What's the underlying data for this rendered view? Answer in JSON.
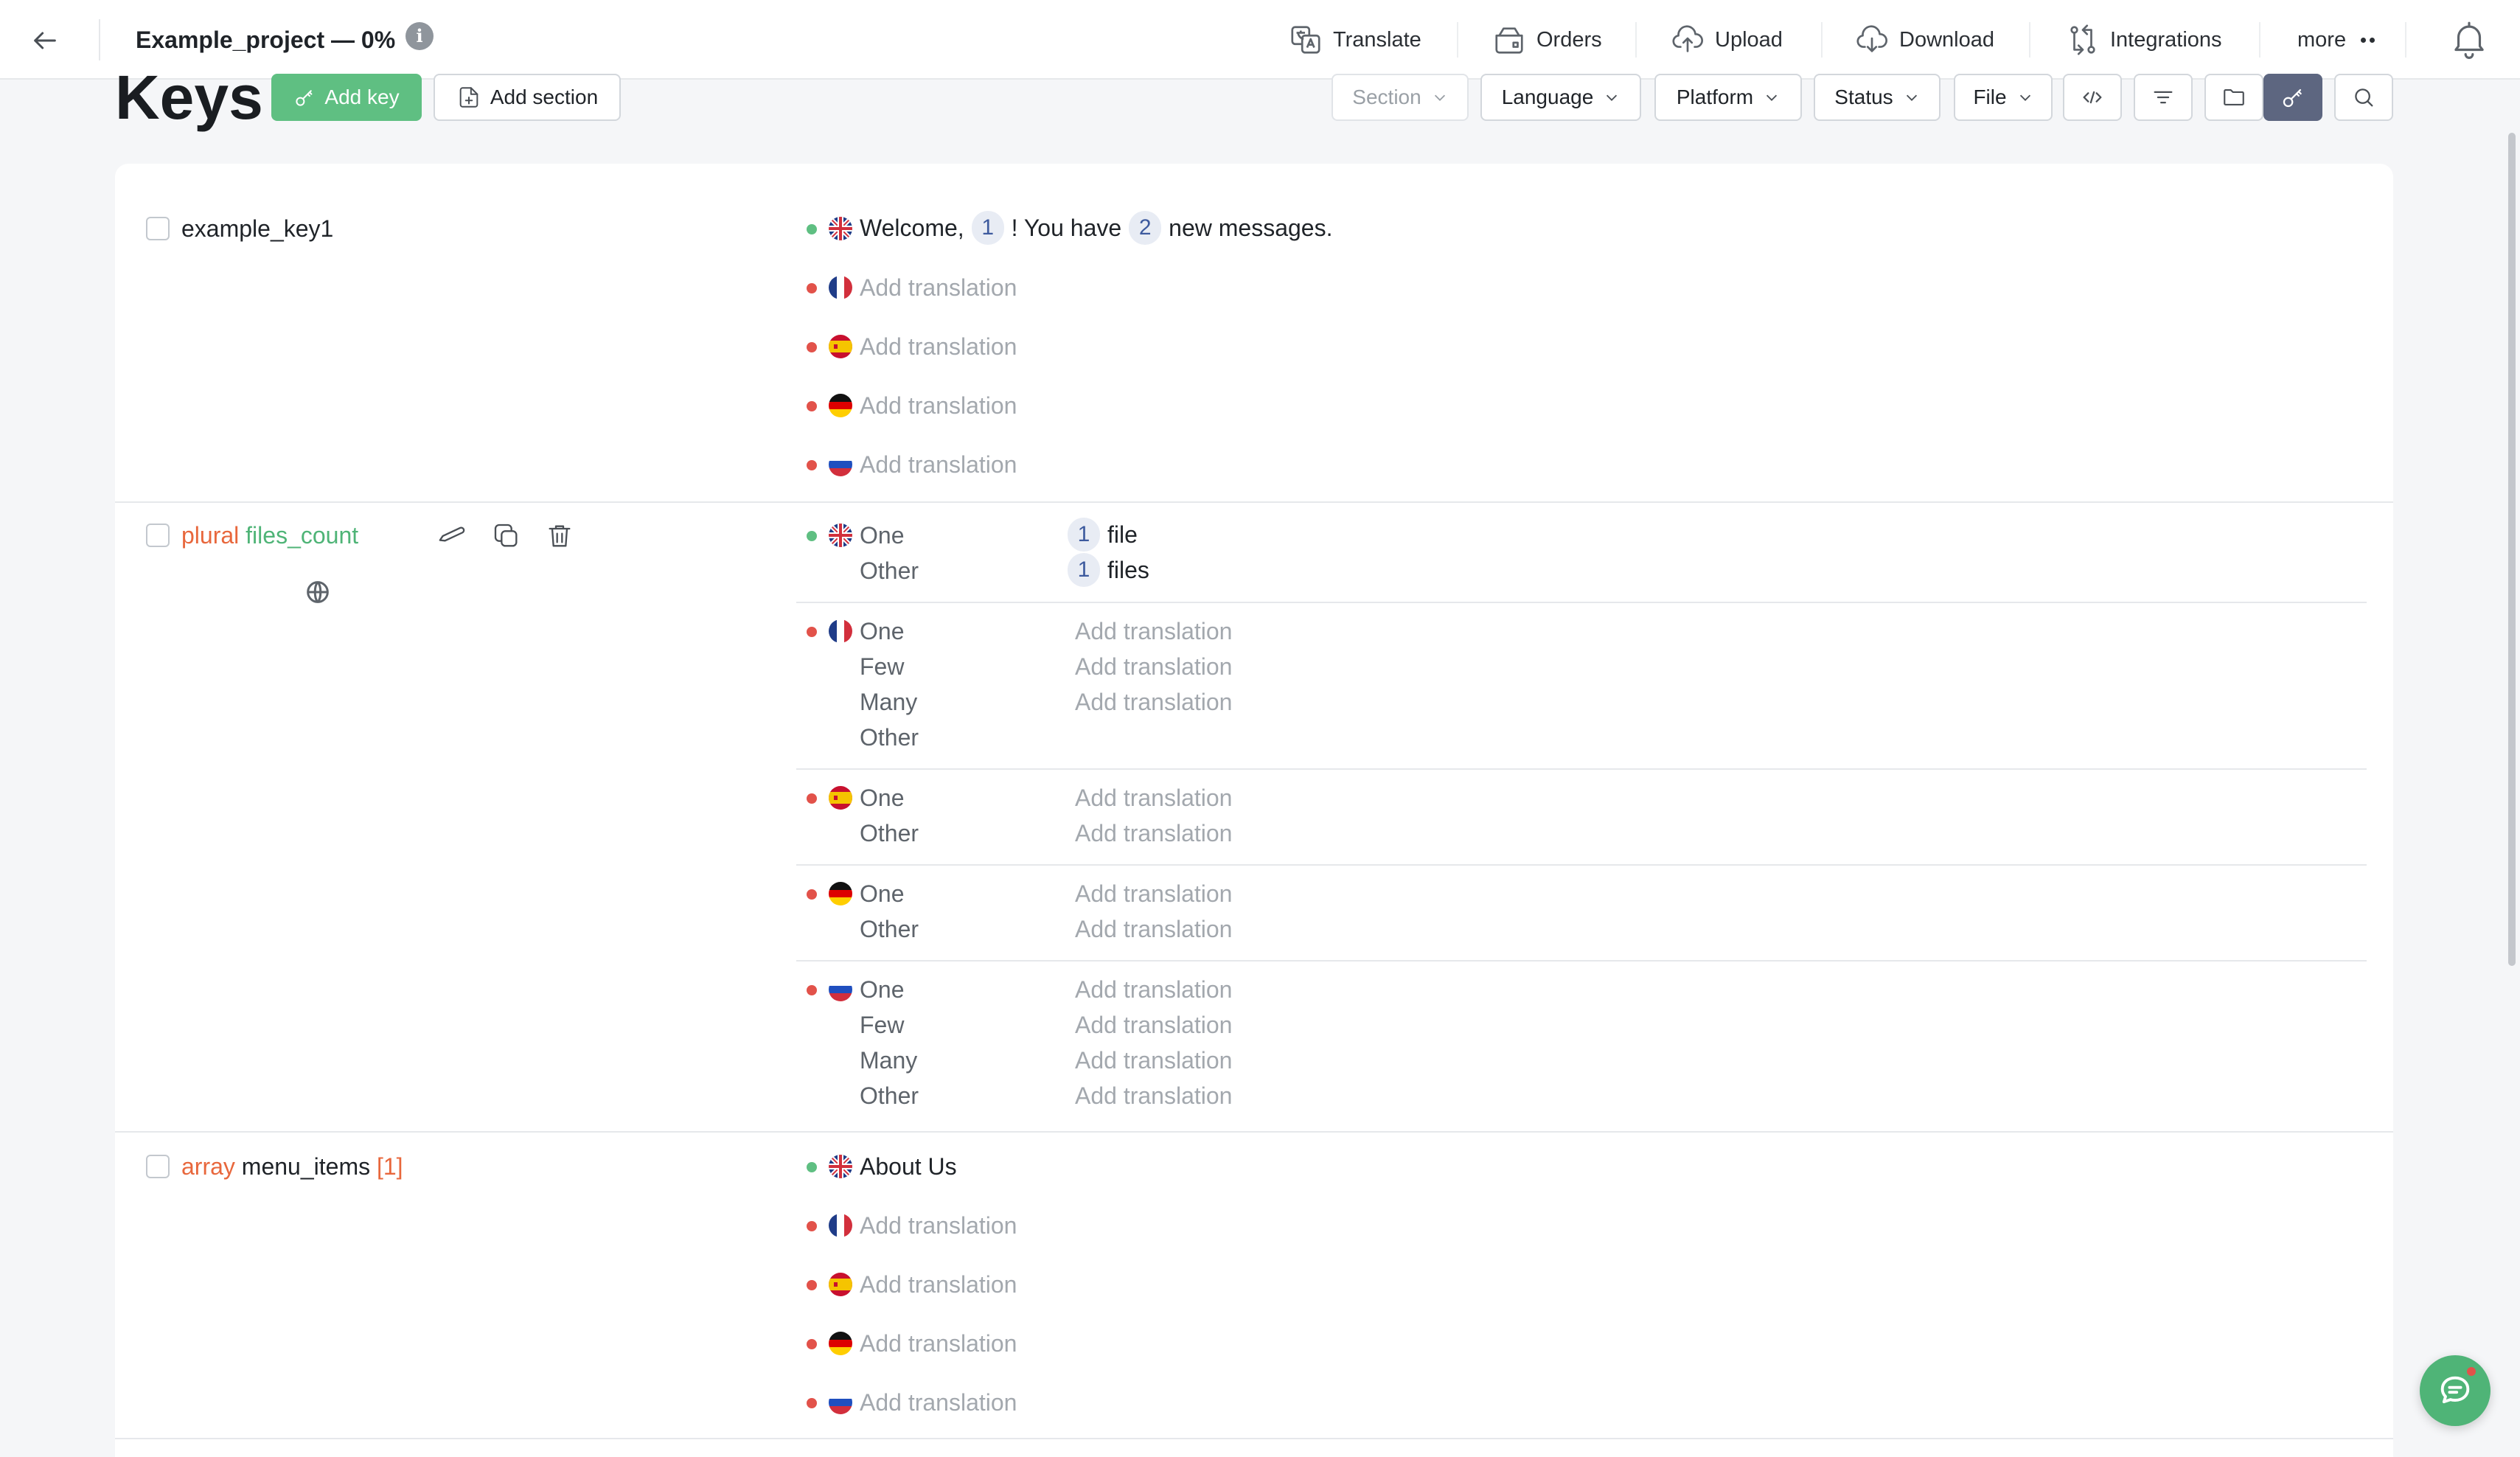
{
  "header": {
    "project_title": "Example_project — 0%",
    "nav": [
      {
        "label": "Translate",
        "icon": "translate-icon"
      },
      {
        "label": "Orders",
        "icon": "orders-icon"
      },
      {
        "label": "Upload",
        "icon": "upload-icon"
      },
      {
        "label": "Download",
        "icon": "download-icon"
      },
      {
        "label": "Integrations",
        "icon": "integrations-icon"
      },
      {
        "label": "more",
        "icon": "more-dots-icon"
      }
    ]
  },
  "toolbar": {
    "title": "Keys",
    "add_key_label": "Add key",
    "add_section_label": "Add section",
    "filters": [
      {
        "label": "Section",
        "muted": true
      },
      {
        "label": "Language"
      },
      {
        "label": "Platform"
      },
      {
        "label": "Status"
      },
      {
        "label": "File"
      }
    ],
    "tools": [
      "code-icon",
      "filter-lines-icon",
      "folder-icon",
      "key-icon",
      "search-icon"
    ],
    "active_tool": "key-icon"
  },
  "placeholder": "Add translation",
  "keys": [
    {
      "name": "example_key1",
      "translations": [
        {
          "lang": "en",
          "status": "done",
          "parts": [
            "Welcome,",
            "1",
            "! You have",
            "2",
            "new messages."
          ]
        },
        {
          "lang": "fr",
          "status": "missing"
        },
        {
          "lang": "es",
          "status": "missing"
        },
        {
          "lang": "de",
          "status": "missing"
        },
        {
          "lang": "ru",
          "status": "missing"
        }
      ]
    },
    {
      "tag": "plural",
      "name": "files_count",
      "actions": [
        "edit-icon",
        "copy-icon",
        "trash-icon"
      ],
      "sub_icon": "globe-icon",
      "translations": [
        {
          "lang": "en",
          "status": "done",
          "forms": [
            {
              "form": "One",
              "var": "1",
              "text": "file"
            },
            {
              "form": "Other",
              "var": "1",
              "text": "files"
            }
          ]
        },
        {
          "lang": "fr",
          "status": "missing",
          "forms": [
            "One",
            "Few",
            "Many",
            "Other"
          ],
          "placeholders": 3
        },
        {
          "lang": "es",
          "status": "missing",
          "forms": [
            "One",
            "Other"
          ],
          "placeholders": 2
        },
        {
          "lang": "de",
          "status": "missing",
          "forms": [
            "One",
            "Other"
          ],
          "placeholders": 2
        },
        {
          "lang": "ru",
          "status": "missing",
          "forms": [
            "One",
            "Few",
            "Many",
            "Other"
          ],
          "placeholders": 4
        }
      ]
    },
    {
      "tag": "array",
      "name": "menu_items",
      "index": "[1]",
      "translations": [
        {
          "lang": "en",
          "status": "done",
          "text": "About Us"
        },
        {
          "lang": "fr",
          "status": "missing"
        },
        {
          "lang": "es",
          "status": "missing"
        },
        {
          "lang": "de",
          "status": "missing"
        },
        {
          "lang": "ru",
          "status": "missing"
        }
      ]
    }
  ],
  "colors": {
    "accent_green": "#5fbf82",
    "status_done": "#5fbf82",
    "status_missing": "#e2524a",
    "tag_orange": "#e8673c",
    "active_tool_bg": "#5d6680"
  }
}
